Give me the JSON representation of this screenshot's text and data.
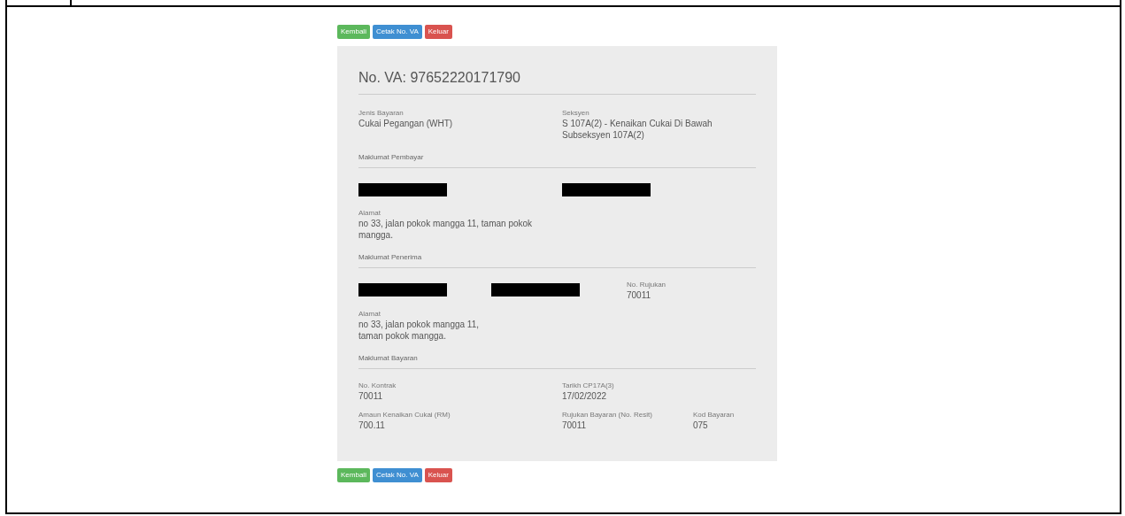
{
  "buttons_top": [
    {
      "label": "Kembali",
      "kind": "back"
    },
    {
      "label": "Cetak No. VA",
      "kind": "print"
    },
    {
      "label": "Keluar",
      "kind": "exit"
    }
  ],
  "title": "No. VA: 97652220171790",
  "sections": [
    {
      "rows": [
        [
          {
            "kind": "text",
            "label": "Jenis Bayaran",
            "value": "Cukai Pegangan (WHT)"
          },
          {
            "kind": "text",
            "label": "Seksyen",
            "value": "S 107A(2) - Kenaikan Cukai Di Bawah Subseksyen 107A(2)"
          }
        ]
      ]
    },
    {
      "heading": "Maklumat Pembayar",
      "rows": [
        [
          {
            "kind": "redacted"
          },
          {
            "kind": "redacted"
          }
        ],
        [
          {
            "kind": "text",
            "label": "Alamat",
            "value": "no 33, jalan pokok mangga 11, taman pokok mangga."
          }
        ]
      ]
    },
    {
      "heading": "Maklumat Penerima",
      "rows": [
        [
          {
            "kind": "redacted"
          },
          {
            "kind": "redacted"
          },
          {
            "kind": "text",
            "label": "No. Rujukan",
            "value": "70011"
          }
        ],
        [
          {
            "kind": "text",
            "label": "Alamat",
            "value": "no 33, jalan pokok mangga 11, taman pokok mangga."
          }
        ]
      ]
    },
    {
      "heading": "Maklumat Bayaran",
      "rows": [
        [
          {
            "kind": "text",
            "label": "No. Kontrak",
            "value": "70011"
          },
          {
            "kind": "text",
            "label": "Tarikh CP17A(3)",
            "value": "17/02/2022"
          }
        ],
        [
          {
            "kind": "text",
            "label": "Amaun Kenaikan Cukai (RM)",
            "value": "700.11"
          },
          {
            "kind": "text",
            "label": "Rujukan Bayaran (No. Resit)",
            "value": "70011"
          },
          {
            "kind": "text",
            "label": "Kod Bayaran",
            "value": "075"
          }
        ]
      ]
    }
  ],
  "buttons_bottom": [
    {
      "label": "Kembali",
      "kind": "back"
    },
    {
      "label": "Cetak No. VA",
      "kind": "print"
    },
    {
      "label": "Keluar",
      "kind": "exit"
    }
  ]
}
